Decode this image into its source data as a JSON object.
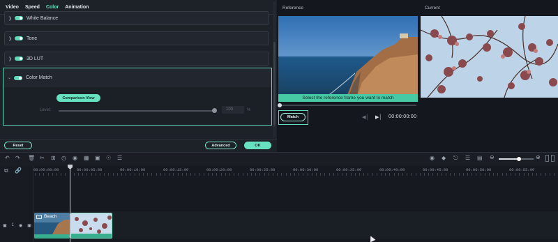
{
  "tabs": [
    "Video",
    "Speed",
    "Color",
    "Animation"
  ],
  "sections": {
    "white_balance": "White Balance",
    "tone": "Tone",
    "lut": "3D LUT",
    "color_match": "Color Match"
  },
  "color_match": {
    "comparison_view": "Comparison View",
    "level_label": "Level:",
    "level_value": "100",
    "level_unit": "%",
    "level_fraction": 1.0
  },
  "footer": {
    "reset": "Reset",
    "advanced": "Advanced",
    "ok": "OK"
  },
  "preview": {
    "reference_label": "Reference",
    "current_label": "Current",
    "reference_banner": "Select the reference frame you want to match",
    "match_button": "Match",
    "timecode": "00:00:00:00"
  },
  "timeline": {
    "ruler": [
      "00:00:00:00",
      "00:00:05:00",
      "00:00:10:00",
      "00:00:15:00",
      "00:00:20:00",
      "00:00:25:00",
      "00:00:30:00",
      "00:00:35:00",
      "00:00:40:00",
      "00:00:45:00",
      "00:00:50:00",
      "00:00:55:00"
    ],
    "clip1_label": "Beach",
    "track_number": "1"
  },
  "colors": {
    "accent": "#66e2c1",
    "panel": "#1d2128",
    "background": "#14171d"
  }
}
